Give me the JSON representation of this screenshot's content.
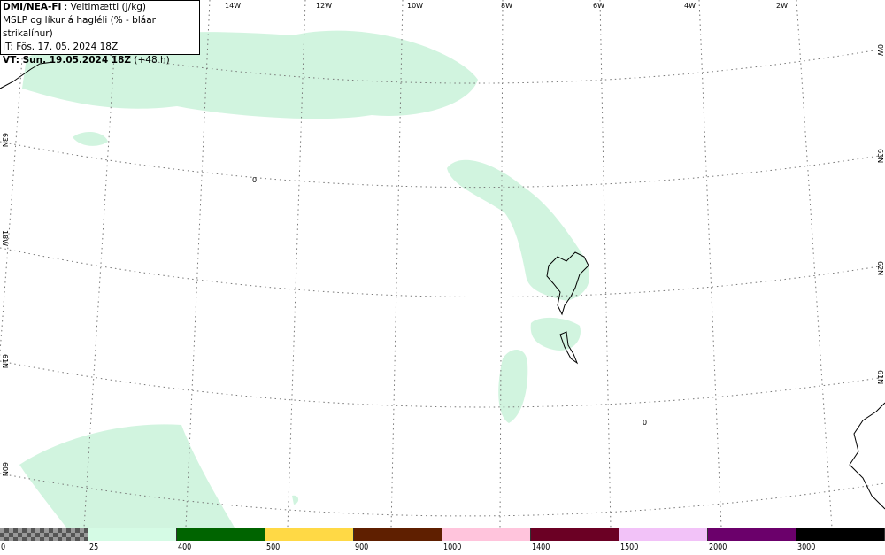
{
  "header": {
    "model": "DMI/NEA-FI",
    "field": " : Veltimætti (J/kg)",
    "subtitle": "MSLP og líkur á hagléli (% - bláar strikalínur)",
    "init_time": "IT: Fös. 17. 05. 2024 18Z",
    "valid_prefix": "VT: Sun. 19.05.2024 18Z",
    "valid_offset": " (+48 h)"
  },
  "lon_labels": [
    "14W",
    "12W",
    "10W",
    "8W",
    "6W",
    "4W",
    "2W",
    "0W"
  ],
  "lat_labels": {
    "left": [
      "63N",
      "18W",
      "61N",
      "60N"
    ],
    "right": [
      "63N",
      "62N",
      "61N"
    ]
  },
  "contour_labels": [
    "0",
    "0"
  ],
  "colorbar": {
    "colors": [
      "checker",
      "#d5fbe5",
      "#006400",
      "#ffd945",
      "#5f1f00",
      "#ffc4dc",
      "#6b0024",
      "#f2c2f8",
      "#6b006b",
      "#000000"
    ],
    "ticks": [
      "0",
      "25",
      "400",
      "500",
      "900",
      "1000",
      "1400",
      "1500",
      "2000",
      "3000"
    ]
  }
}
